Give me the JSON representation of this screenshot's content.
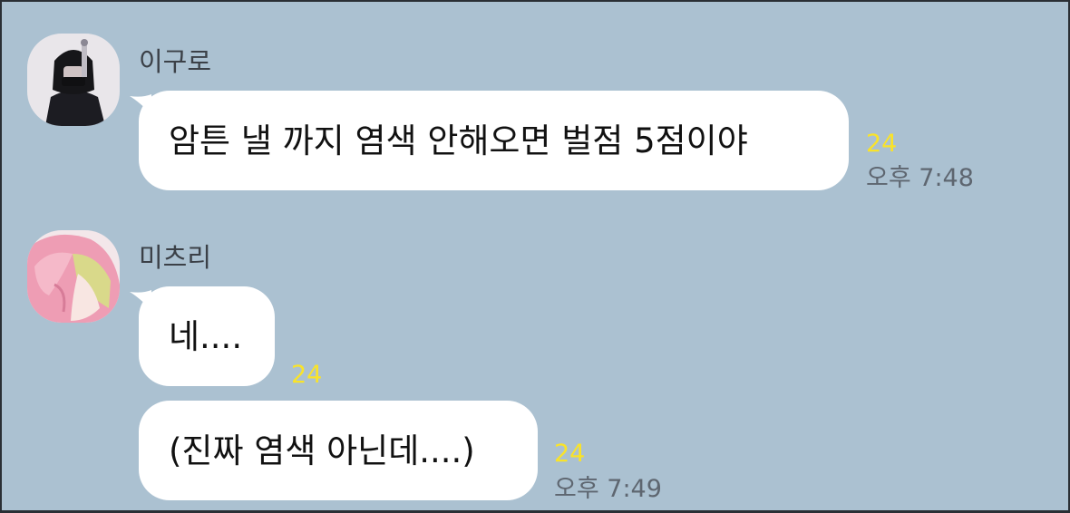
{
  "colors": {
    "background": "#abc1d1",
    "bubble": "#ffffff",
    "unread": "#f9e32a",
    "time": "#5e6670",
    "name": "#3b4047"
  },
  "messages": [
    {
      "sender": "이구로",
      "avatar_icon": "dark-haired-character-avatar-icon",
      "bubbles": [
        {
          "text": "암튼 낼 까지 염색 안해오면 벌점 5점이야",
          "unread": "24",
          "time": "오후 7:48"
        }
      ]
    },
    {
      "sender": "미츠리",
      "avatar_icon": "pink-haired-character-avatar-icon",
      "bubbles": [
        {
          "text": "네....",
          "unread": "24",
          "time": ""
        },
        {
          "text": "(진짜 염색 아닌데....)",
          "unread": "24",
          "time": "오후 7:49"
        }
      ]
    }
  ]
}
